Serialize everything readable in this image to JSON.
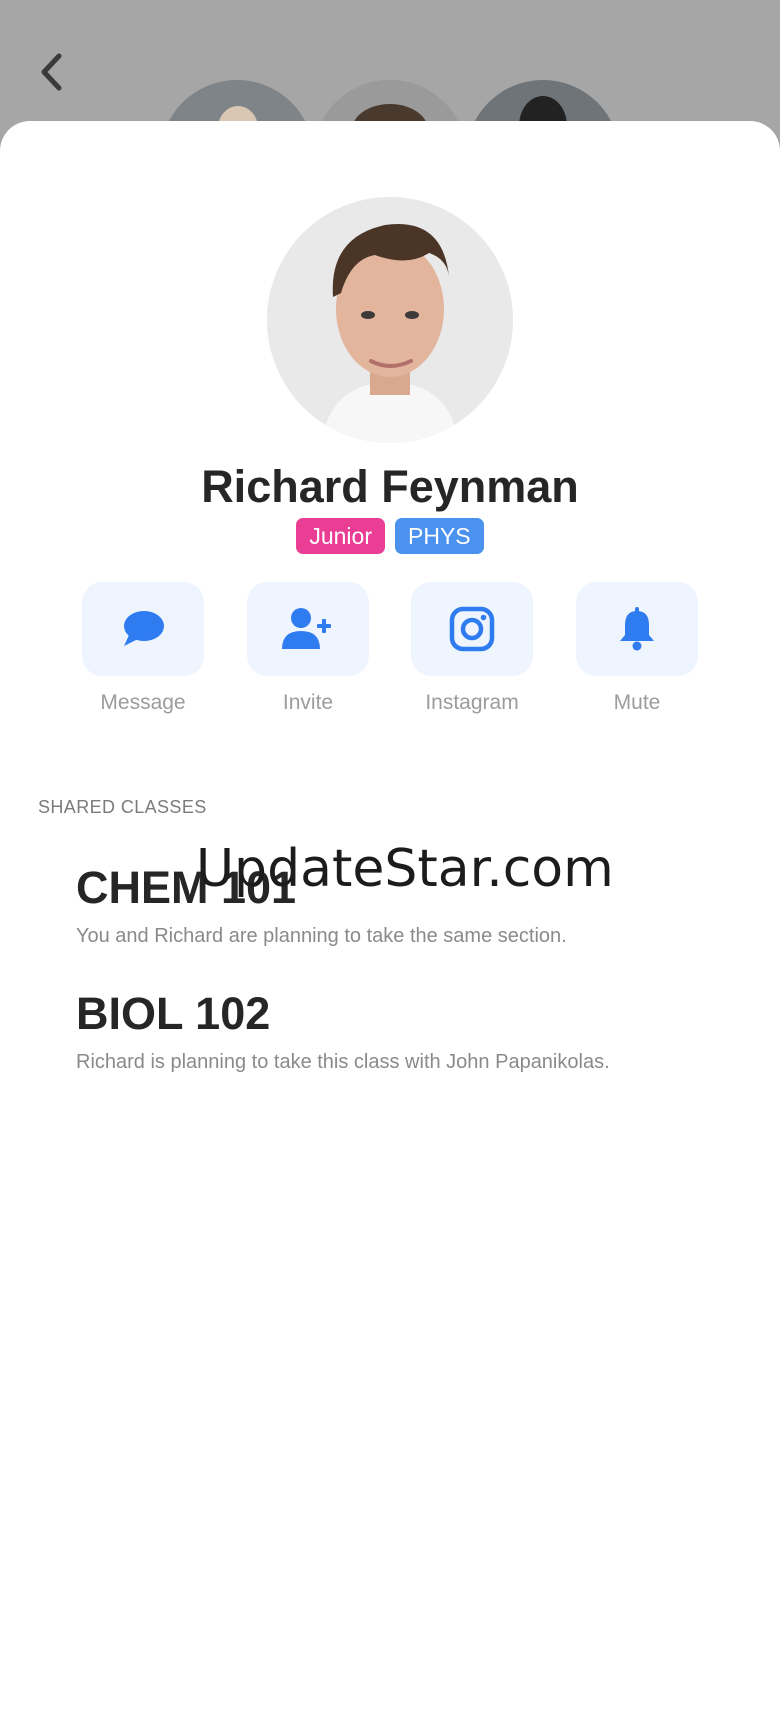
{
  "header": {
    "back_icon": "chevron-left-icon"
  },
  "profile": {
    "name": "Richard Feynman",
    "badges": [
      {
        "label": "Junior",
        "color": "#ea3e94"
      },
      {
        "label": "PHYS",
        "color": "#4b92ee"
      }
    ]
  },
  "actions": [
    {
      "label": "Message",
      "icon": "chat-bubble-icon"
    },
    {
      "label": "Invite",
      "icon": "add-user-icon"
    },
    {
      "label": "Instagram",
      "icon": "instagram-icon"
    },
    {
      "label": "Mute",
      "icon": "bell-icon"
    }
  ],
  "shared_classes": {
    "title": "SHARED CLASSES",
    "items": [
      {
        "code": "CHEM 101",
        "description": "You and Richard are planning to take the same section."
      },
      {
        "code": "BIOL 102",
        "description": "Richard is planning to take this class with John Papanikolas."
      }
    ]
  },
  "watermark": "UpdateStar.com",
  "colors": {
    "accent": "#2f7bf0",
    "action_bg": "#eff5ff"
  }
}
